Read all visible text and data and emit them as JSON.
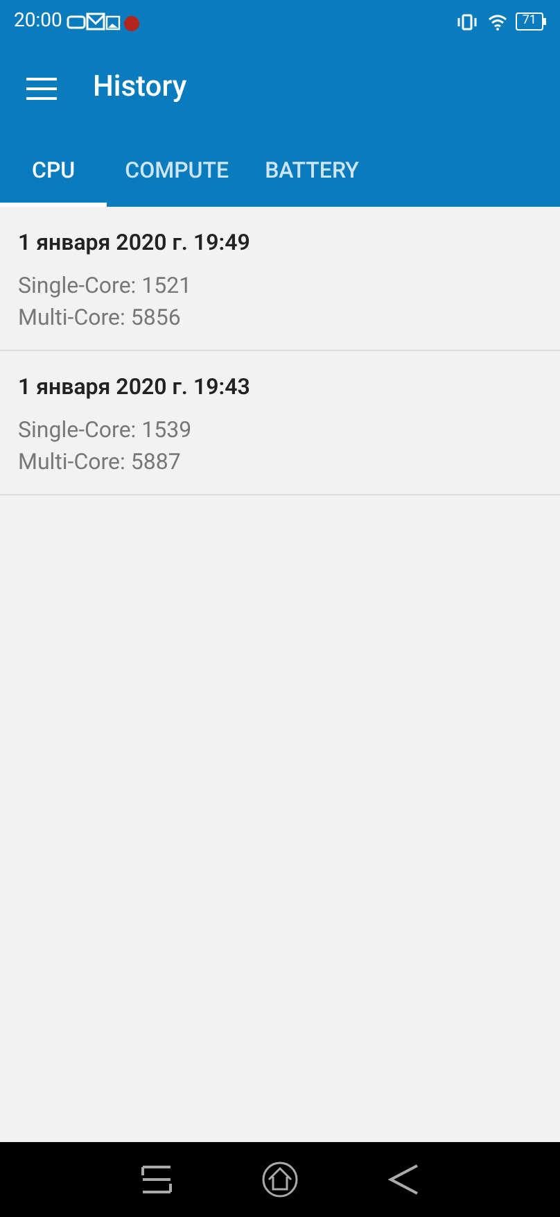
{
  "status_bar": {
    "time": "20:00",
    "battery": "71"
  },
  "toolbar": {
    "title": "History"
  },
  "tabs": [
    {
      "label": "CPU",
      "selected": true
    },
    {
      "label": "COMPUTE",
      "selected": false
    },
    {
      "label": "BATTERY",
      "selected": false
    }
  ],
  "results": [
    {
      "date": "1 января 2020 г. 19:49",
      "single_core": "Single-Core: 1521",
      "multi_core": "Multi-Core: 5856"
    },
    {
      "date": "1 января 2020 г. 19:43",
      "single_core": "Single-Core: 1539",
      "multi_core": "Multi-Core: 5887"
    }
  ]
}
